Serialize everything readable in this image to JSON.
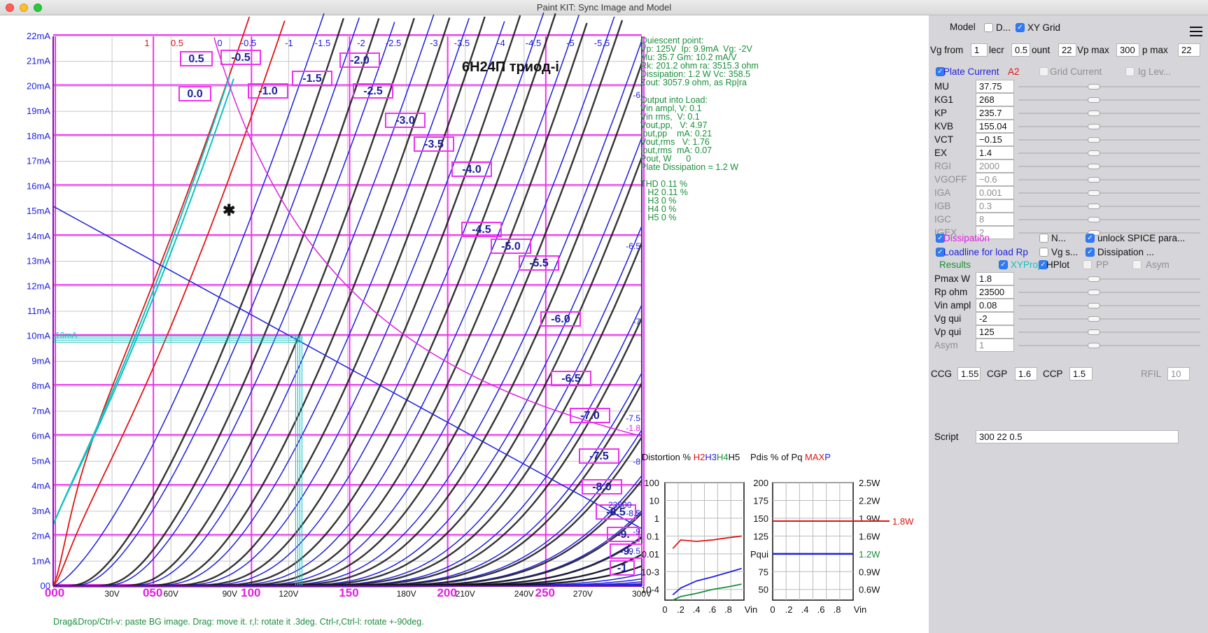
{
  "window": {
    "title": "Paint KIT: Sync Image and Model"
  },
  "chart_data": [
    {
      "type": "line",
      "title": "6Н24П триод-i",
      "xlabel": "",
      "ylabel": "",
      "x_ticks": [
        "000",
        "30V",
        "050",
        "60V",
        "90V",
        "100",
        "120V",
        "150",
        "180V",
        "200",
        "210V",
        "240V",
        "250",
        "270V",
        "300V"
      ],
      "x_tick_values": [
        0,
        30,
        50,
        60,
        90,
        100,
        120,
        150,
        180,
        200,
        210,
        240,
        250,
        270,
        300
      ],
      "y_ticks": [
        "00",
        "1mA",
        "2mA",
        "3mA",
        "4mA",
        "5mA",
        "6mA",
        "7mA",
        "8mA",
        "9mA",
        "10mA",
        "11mA",
        "12mA",
        "13mA",
        "14mA",
        "15mA",
        "16mA",
        "17mA",
        "18mA",
        "19mA",
        "20mA",
        "21mA",
        "22mA"
      ],
      "xlim": [
        0,
        300
      ],
      "ylim": [
        0,
        22
      ],
      "grid": true,
      "grid_labels": [
        "1",
        "0.5",
        "0",
        "-0.5",
        "-1",
        "-1.5",
        "-2",
        "-2.5",
        "-3",
        "-3.5",
        "-4",
        "-4.5",
        "-5",
        "-5.5"
      ],
      "boxed_labels": [
        "0.5",
        "-0.5",
        "0.0",
        "-1.0",
        "-1.5",
        "-2.0",
        "-2.5",
        "-3.0",
        "-3.5",
        "-4.0",
        "-4.5",
        "-5.0",
        "-5.5",
        "-6.0",
        "-6.5",
        "-7.0",
        "-7.5",
        "-8.0",
        "-8.5",
        "-9.",
        "-9.",
        "-1"
      ],
      "boxed_label_vg": [
        0.5,
        -0.5,
        0,
        -1,
        -1.5,
        -2,
        -2.5,
        -3,
        -3.5,
        -4,
        -4.5,
        -5,
        -5.5,
        -6,
        -6.5,
        -7,
        -7.5,
        -8,
        -8.5,
        -9,
        -9.5,
        -10
      ],
      "right_labels": [
        "-6",
        "-6.5",
        "-7",
        "-7.5",
        "-1.8",
        "-8",
        "23500",
        "-8.5",
        "-9",
        "-9.5"
      ],
      "series_vg": [
        1,
        0.5,
        0,
        -0.5,
        -1,
        -1.5,
        -2,
        -2.5,
        -3,
        -3.5,
        -4,
        -4.5,
        -5,
        -5.5,
        -6,
        -6.5,
        -7,
        -7.5,
        -8,
        -8.5,
        -9,
        -9.5,
        -10,
        -10.5,
        -11,
        -11.5,
        -12,
        -12.5,
        -13,
        -13.5
      ],
      "loadline": {
        "vp": [
          0,
          300
        ],
        "ip_mA": [
          15.2,
          2.3
        ]
      },
      "quiescent": {
        "vp": 125,
        "ip_mA": 9.9,
        "label": "10mA"
      },
      "dissipation_watts": 1.8,
      "colors": {
        "grid": "#ee33ee",
        "model": "#1f1fdd",
        "trace": "#111111",
        "red": "#e01515",
        "cyan": "#11bfbf",
        "axis": "#7711aa",
        "ticks": "#e020e0"
      }
    },
    {
      "type": "line",
      "title": "Distortion %",
      "legend_parts": [
        "H2",
        "H3",
        "H4",
        "H5"
      ],
      "legend_colors": [
        "#e01515",
        "#1f1fdd",
        "#1a8f3a",
        "#111111"
      ],
      "y_ticks": [
        "100",
        "10",
        "1",
        "0.1",
        "0.01",
        "10-3",
        "10-4"
      ],
      "x_ticks": [
        "0",
        ".2",
        ".4",
        ".6",
        ".8",
        "Vin"
      ],
      "x": [
        0.1,
        0.2,
        0.4,
        0.6,
        0.8,
        0.97
      ],
      "series": [
        {
          "values": [
            0.02,
            0.06,
            0.05,
            0.06,
            0.08,
            0.1
          ]
        },
        {
          "values": [
            5e-05,
            0.00012,
            0.0003,
            0.0005,
            0.0009,
            0.0015
          ]
        },
        {
          "values": [
            2e-05,
            4e-05,
            6e-05,
            0.0001,
            0.00014,
            0.0002
          ]
        }
      ]
    },
    {
      "type": "line",
      "title": "Pdis % of Pq",
      "legend_parts": [
        "MAX",
        "P"
      ],
      "legend_colors": [
        "#e01515",
        "#1f1fdd"
      ],
      "y_ticks": [
        "200",
        "175",
        "150",
        "125",
        "Pqui",
        "75",
        "50"
      ],
      "y_ticks_right": [
        "2.5W",
        "2.2W",
        "1.9W",
        "1.6W",
        "1.2W",
        "0.9W",
        "0.6W"
      ],
      "x_ticks": [
        "0",
        ".2",
        ".4",
        ".6",
        ".8",
        "Vin"
      ],
      "max_label": "1.8W",
      "max_value": 146,
      "pqui_value": 100
    }
  ],
  "info": {
    "quiescent": [
      "Quiescent point:",
      "Vp: 125V  Ip: 9.9mA  Vg: -2V",
      "Mu: 35.7 Gm: 10.2 mA/V",
      "Rk: 201.2 ohm ra: 3515.3 ohm",
      "Dissipation: 1.2 W Vc: 358.5",
      "Zout: 3057.9 ohm, as Rp|ra"
    ],
    "output": [
      "Output into Load:",
      "Vin ampl, V: 0.1",
      "Vin rms,  V: 0.1",
      "Vout,pp,   V: 4.97",
      "Iout,pp    mA: 0.21",
      "Vout,rms   V: 1.76",
      "Iout,rms  mA: 0.07",
      "Pout, W      0",
      "Plate Dissipation = 1.2 W"
    ],
    "thd": [
      "THD 0.11 %",
      "   H2 0.11 %",
      "   H3 0 %",
      "   H4 0 %",
      "   H5 0 %"
    ]
  },
  "status_bar": "Drag&Drop/Ctrl-v: paste BG image. Drag: move it. r,l: rotate it .3deg. Ctrl-r,Ctrl-l: rotate +-90deg.",
  "panel": {
    "model_label": "Model",
    "d_label": "D...",
    "xygrid_label": "XY Grid",
    "vg_from_label": "Vg from",
    "vg_from": "1",
    "decr_label": "lecr",
    "decr": "0.5",
    "count_label": "ount",
    "count": "22",
    "vpmax_label": "Vp max",
    "vpmax": "300",
    "ipmax_label": "p max",
    "ipmax": "22",
    "plate_current": "Plate Current",
    "a2": "A2",
    "grid_current": "Grid Current",
    "ig_lev": "Ig Lev...",
    "params": [
      {
        "name": "MU",
        "value": "37.75",
        "knob": 0.41,
        "grey": false
      },
      {
        "name": "KG1",
        "value": "268",
        "knob": 0.41,
        "grey": false
      },
      {
        "name": "KP",
        "value": "235.7",
        "knob": 0.41,
        "grey": false
      },
      {
        "name": "KVB",
        "value": "155.04",
        "knob": 0.41,
        "grey": false
      },
      {
        "name": "VCT",
        "value": "−0.15",
        "knob": 0.41,
        "grey": false
      },
      {
        "name": "EX",
        "value": "1.4",
        "knob": 0.41,
        "grey": false
      },
      {
        "name": "RGI",
        "value": "2000",
        "knob": 0.41,
        "grey": true
      },
      {
        "name": "VGOFF",
        "value": "−0.6",
        "knob": 0.41,
        "grey": true
      },
      {
        "name": "IGA",
        "value": "0.001",
        "knob": 0.41,
        "grey": true
      },
      {
        "name": "IGB",
        "value": "0.3",
        "knob": 0.41,
        "grey": true
      },
      {
        "name": "IGC",
        "value": "8",
        "knob": 0.41,
        "grey": true
      },
      {
        "name": "IGEX",
        "value": "2",
        "knob": 0.41,
        "grey": true
      }
    ],
    "dissipation": "Dissipation",
    "n_label": "N...",
    "unlock_label": "unlock SPICE para...",
    "loadline_label": "Loadline for load Rp",
    "vgs_label": "Vg s...",
    "dissipation2_label": "Dissipation ...",
    "results_label": "Results",
    "xyproj_label": "XYProj",
    "hplot_label": "HPlot",
    "pp_label": "PP",
    "asym_label": "Asym",
    "results": [
      {
        "name": "Pmax W",
        "value": "1.8",
        "knob": 0.41,
        "grey": false
      },
      {
        "name": "Rp ohm",
        "value": "23500",
        "knob": 0.41,
        "grey": false
      },
      {
        "name": "Vin ampl",
        "value": "0.08",
        "knob": 0.41,
        "grey": false
      },
      {
        "name": "Vg qui",
        "value": "-2",
        "knob": 0.41,
        "grey": false
      },
      {
        "name": "Vp qui",
        "value": "125",
        "knob": 0.41,
        "grey": false
      },
      {
        "name": "Asym",
        "value": "1",
        "knob": 0.41,
        "grey": true
      }
    ],
    "ccg_label": "CCG",
    "ccg": "1.55",
    "cgp_label": "CGP",
    "cgp": "1.6",
    "ccp_label": "CCP",
    "ccp": "1.5",
    "rfil_label": "RFIL",
    "rfil": "10",
    "script_label": "Script",
    "script": "300 22 0.5"
  }
}
